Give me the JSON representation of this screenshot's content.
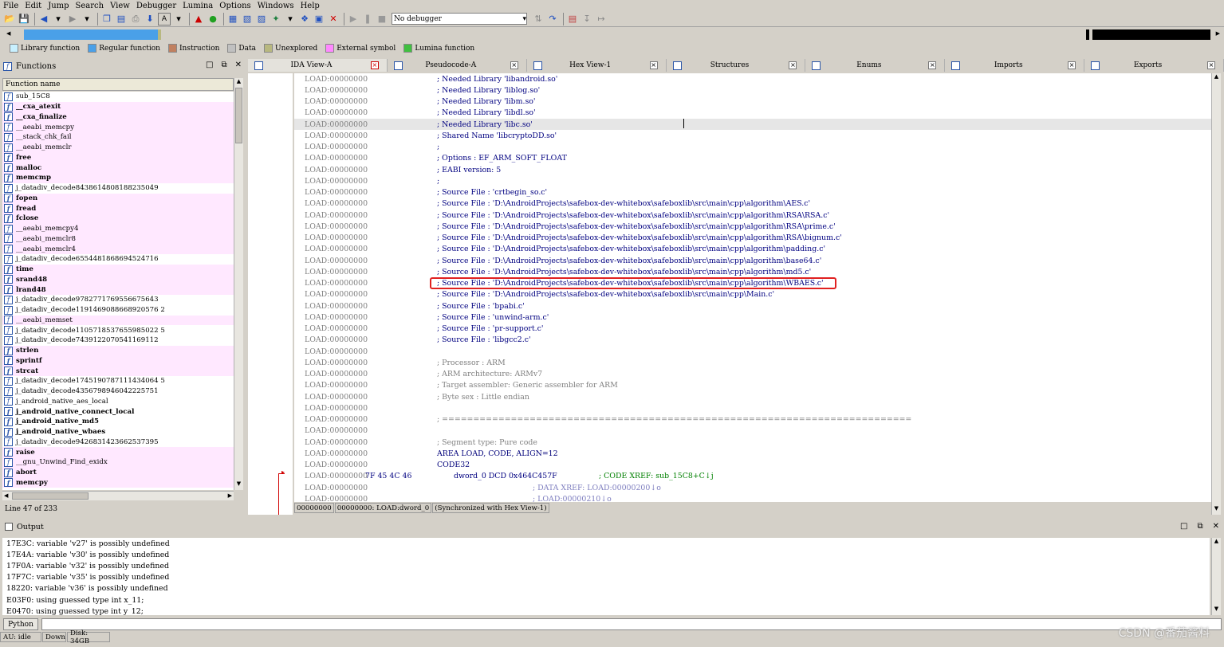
{
  "menu": [
    "File",
    "Edit",
    "Jump",
    "Search",
    "View",
    "Debugger",
    "Lumina",
    "Options",
    "Windows",
    "Help"
  ],
  "toolbar": {
    "debugger_select": "No debugger"
  },
  "legend": [
    {
      "label": "Library function",
      "color": "#c8f0ff"
    },
    {
      "label": "Regular function",
      "color": "#4aa0e8"
    },
    {
      "label": "Instruction",
      "color": "#c08060"
    },
    {
      "label": "Data",
      "color": "#c0c0c0"
    },
    {
      "label": "Unexplored",
      "color": "#b8b880"
    },
    {
      "label": "External symbol",
      "color": "#ff88ff"
    },
    {
      "label": "Lumina function",
      "color": "#40c040"
    }
  ],
  "functions_panel": {
    "title": "Functions",
    "column": "Function name",
    "status": "Line 47 of 233",
    "items": [
      {
        "name": "sub_15C8",
        "lib": false,
        "bold": false
      },
      {
        "name": "__cxa_atexit",
        "lib": true,
        "bold": true
      },
      {
        "name": "__cxa_finalize",
        "lib": true,
        "bold": true
      },
      {
        "name": "__aeabi_memcpy",
        "lib": true,
        "bold": false
      },
      {
        "name": "__stack_chk_fail",
        "lib": true,
        "bold": false
      },
      {
        "name": "__aeabi_memclr",
        "lib": true,
        "bold": false
      },
      {
        "name": "free",
        "lib": true,
        "bold": true
      },
      {
        "name": "malloc",
        "lib": true,
        "bold": true
      },
      {
        "name": "memcmp",
        "lib": true,
        "bold": true
      },
      {
        "name": "j_datadiv_decode8438614808188235049",
        "lib": false,
        "bold": false
      },
      {
        "name": "fopen",
        "lib": true,
        "bold": true
      },
      {
        "name": "fread",
        "lib": true,
        "bold": true
      },
      {
        "name": "fclose",
        "lib": true,
        "bold": true
      },
      {
        "name": "__aeabi_memcpy4",
        "lib": true,
        "bold": false
      },
      {
        "name": "__aeabi_memclr8",
        "lib": true,
        "bold": false
      },
      {
        "name": "__aeabi_memclr4",
        "lib": true,
        "bold": false
      },
      {
        "name": "j_datadiv_decode6554481868694524716",
        "lib": false,
        "bold": false
      },
      {
        "name": "time",
        "lib": true,
        "bold": true
      },
      {
        "name": "srand48",
        "lib": true,
        "bold": true
      },
      {
        "name": "lrand48",
        "lib": true,
        "bold": true
      },
      {
        "name": "j_datadiv_decode9782771769556675643",
        "lib": false,
        "bold": false
      },
      {
        "name": "j_datadiv_decode1191469088668920576 2",
        "lib": false,
        "bold": false
      },
      {
        "name": "__aeabi_memset",
        "lib": true,
        "bold": false
      },
      {
        "name": "j_datadiv_decode1105718537655985022 5",
        "lib": false,
        "bold": false
      },
      {
        "name": "j_datadiv_decode7439122070541169112",
        "lib": false,
        "bold": false
      },
      {
        "name": "strlen",
        "lib": true,
        "bold": true
      },
      {
        "name": "sprintf",
        "lib": true,
        "bold": true
      },
      {
        "name": "strcat",
        "lib": true,
        "bold": true
      },
      {
        "name": "j_datadiv_decode1745190787111434064 5",
        "lib": false,
        "bold": false
      },
      {
        "name": "j_datadiv_decode4356798946042225751",
        "lib": false,
        "bold": false
      },
      {
        "name": "j_android_native_aes_local",
        "lib": false,
        "bold": false
      },
      {
        "name": "j_android_native_connect_local",
        "lib": false,
        "bold": true
      },
      {
        "name": "j_android_native_md5",
        "lib": false,
        "bold": true
      },
      {
        "name": "j_android_native_wbaes",
        "lib": false,
        "bold": true
      },
      {
        "name": "j_datadiv_decode9426831423662537395",
        "lib": false,
        "bold": false
      },
      {
        "name": "raise",
        "lib": true,
        "bold": true
      },
      {
        "name": "__gnu_Unwind_Find_exidx",
        "lib": true,
        "bold": false
      },
      {
        "name": "abort",
        "lib": true,
        "bold": true
      },
      {
        "name": "memcpy",
        "lib": true,
        "bold": true
      }
    ]
  },
  "tabs": [
    {
      "label": "IDA View-A",
      "active": true
    },
    {
      "label": "Pseudocode-A",
      "active": false
    },
    {
      "label": "Hex View-1",
      "active": false
    },
    {
      "label": "Structures",
      "active": false
    },
    {
      "label": "Enums",
      "active": false
    },
    {
      "label": "Imports",
      "active": false
    },
    {
      "label": "Exports",
      "active": false
    }
  ],
  "disasm": [
    {
      "addr": "LOAD:00000000",
      "text": "; Needed Library 'libandroid.so'"
    },
    {
      "addr": "LOAD:00000000",
      "text": "; Needed Library 'liblog.so'"
    },
    {
      "addr": "LOAD:00000000",
      "text": "; Needed Library 'libm.so'"
    },
    {
      "addr": "LOAD:00000000",
      "text": "; Needed Library 'libdl.so'"
    },
    {
      "addr": "LOAD:00000000",
      "text": "; Needed Library 'libc.so'",
      "hl": true
    },
    {
      "addr": "LOAD:00000000",
      "text": "; Shared Name 'libcryptoDD.so'"
    },
    {
      "addr": "LOAD:00000000",
      "text": ";"
    },
    {
      "addr": "LOAD:00000000",
      "text": "; Options     : EF_ARM_SOFT_FLOAT"
    },
    {
      "addr": "LOAD:00000000",
      "text": "; EABI version: 5"
    },
    {
      "addr": "LOAD:00000000",
      "text": ";"
    },
    {
      "addr": "LOAD:00000000",
      "text": "; Source File : 'crtbegin_so.c'"
    },
    {
      "addr": "LOAD:00000000",
      "text": "; Source File : 'D:\\AndroidProjects\\safebox-dev-whitebox\\safeboxlib\\src\\main\\cpp\\algorithm\\AES.c'"
    },
    {
      "addr": "LOAD:00000000",
      "text": "; Source File : 'D:\\AndroidProjects\\safebox-dev-whitebox\\safeboxlib\\src\\main\\cpp\\algorithm\\RSA\\RSA.c'"
    },
    {
      "addr": "LOAD:00000000",
      "text": "; Source File : 'D:\\AndroidProjects\\safebox-dev-whitebox\\safeboxlib\\src\\main\\cpp\\algorithm\\RSA\\prime.c'"
    },
    {
      "addr": "LOAD:00000000",
      "text": "; Source File : 'D:\\AndroidProjects\\safebox-dev-whitebox\\safeboxlib\\src\\main\\cpp\\algorithm\\RSA\\bignum.c'"
    },
    {
      "addr": "LOAD:00000000",
      "text": "; Source File : 'D:\\AndroidProjects\\safebox-dev-whitebox\\safeboxlib\\src\\main\\cpp\\algorithm\\padding.c'"
    },
    {
      "addr": "LOAD:00000000",
      "text": "; Source File : 'D:\\AndroidProjects\\safebox-dev-whitebox\\safeboxlib\\src\\main\\cpp\\algorithm\\base64.c'"
    },
    {
      "addr": "LOAD:00000000",
      "text": "; Source File : 'D:\\AndroidProjects\\safebox-dev-whitebox\\safeboxlib\\src\\main\\cpp\\algorithm\\md5.c'"
    },
    {
      "addr": "LOAD:00000000",
      "text": "; Source File : 'D:\\AndroidProjects\\safebox-dev-whitebox\\safeboxlib\\src\\main\\cpp\\algorithm\\WBAES.c'"
    },
    {
      "addr": "LOAD:00000000",
      "text": "; Source File : 'D:\\AndroidProjects\\safebox-dev-whitebox\\safeboxlib\\src\\main\\cpp\\Main.c'"
    },
    {
      "addr": "LOAD:00000000",
      "text": "; Source File : 'bpabi.c'"
    },
    {
      "addr": "LOAD:00000000",
      "text": "; Source File : 'unwind-arm.c'"
    },
    {
      "addr": "LOAD:00000000",
      "text": "; Source File : 'pr-support.c'"
    },
    {
      "addr": "LOAD:00000000",
      "text": "; Source File : 'libgcc2.c'"
    },
    {
      "addr": "LOAD:00000000",
      "text": ""
    },
    {
      "addr": "LOAD:00000000",
      "text": "; Processor       : ARM",
      "grey": true
    },
    {
      "addr": "LOAD:00000000",
      "text": "; ARM architecture: ARMv7",
      "grey": true
    },
    {
      "addr": "LOAD:00000000",
      "text": "; Target assembler: Generic assembler for ARM",
      "grey": true
    },
    {
      "addr": "LOAD:00000000",
      "text": "; Byte sex        : Little endian",
      "grey": true
    },
    {
      "addr": "LOAD:00000000",
      "text": ""
    },
    {
      "addr": "LOAD:00000000",
      "text": "; ===========================================================================",
      "grey": true
    },
    {
      "addr": "LOAD:00000000",
      "text": ""
    },
    {
      "addr": "LOAD:00000000",
      "text": "; Segment type: Pure code",
      "grey": true
    },
    {
      "addr": "LOAD:00000000",
      "text": "AREA LOAD, CODE, ALIGN=12",
      "ins": true
    },
    {
      "addr": "LOAD:00000000",
      "text": "CODE32",
      "ins": true
    },
    {
      "addr": "LOAD:00000000",
      "bytes": "7F 45 4C 46",
      "text": "dword_0 DCD 0x464C457F",
      "xref": "; CODE XREF: sub_15C8+C↓j"
    },
    {
      "addr": "LOAD:00000000",
      "text": "",
      "xref2": "; DATA XREF: LOAD:00000200↓o"
    },
    {
      "addr": "LOAD:00000000",
      "text": "",
      "xref2": "; LOAD:00000210↓o"
    }
  ],
  "disasm_status": [
    "00000000",
    "00000000: LOAD:dword_0",
    "(Synchronized with Hex View-1)"
  ],
  "output": {
    "title": "Output",
    "lines": [
      "17E3C: variable 'v27' is possibly undefined",
      "17E4A: variable 'v30' is possibly undefined",
      "17F0A: variable 'v32' is possibly undefined",
      "17F7C: variable 'v35' is possibly undefined",
      "18220: variable 'v36' is possibly undefined",
      "E03F0: using guessed type int x_11;",
      "E0470: using guessed type int y_12;"
    ],
    "python_label": "Python"
  },
  "statusbar": [
    "AU:  idle",
    "Down",
    "Disk: 34GB"
  ],
  "watermark": "CSDN @番茄酱料"
}
